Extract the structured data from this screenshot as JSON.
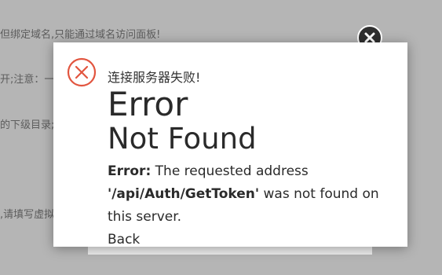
{
  "background": {
    "lines": [
      "但绑定域名,只能通过域名访问面板!",
      "开;注意：一",
      "的下级目录;",
      ",请填写虚拟"
    ]
  },
  "dialog": {
    "title": "连接服务器失败!",
    "icon": "error-x-circle-icon",
    "accent_color": "#e2553f",
    "heading_1": "Error",
    "heading_2": "Not Found",
    "message": {
      "label": "Error:",
      "text_1": " The requested address ",
      "path": "'/api/Auth/GetToken'",
      "text_2": " was not found on this server."
    },
    "back_label": "Back"
  }
}
